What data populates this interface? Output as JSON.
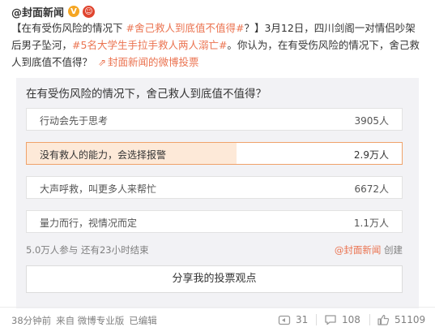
{
  "author": {
    "name": "@封面新闻",
    "verified_mark": "V",
    "emoji": "☺"
  },
  "post": {
    "part1": "【在有受伤风险的情况下 ",
    "topic1": "#舍己救人到底值不值得#",
    "part2": "？】3月12日，四川剑阁一对情侣吵架后男子坠河，",
    "topic2": "#5名大学生手拉手救人两人溺亡#",
    "part3": "。你认为，在有受伤风险的情况下，舍己救人到底值不值得？ ",
    "poll_link": "封面新闻的微博投票",
    "poll_link_icon": "link-icon"
  },
  "poll": {
    "question": "在有受伤风险的情况下，舍己救人到底值不值得？",
    "options": [
      {
        "label": "行动会先于思考",
        "count": "3905人",
        "share": 0.08
      },
      {
        "label": "没有救人的能力，会选择报警",
        "count": "2.9万人",
        "share": 0.56,
        "selected": true
      },
      {
        "label": "大声呼救，叫更多人来帮忙",
        "count": "6672人",
        "share": 0.13
      },
      {
        "label": "量力而行，视情况而定",
        "count": "1.1万人",
        "share": 0.22
      }
    ],
    "meta": "5.0万人参与 还有23小时结束",
    "creator_name": "@封面新闻",
    "creator_suffix": " 创建",
    "share_button": "分享我的投票观点"
  },
  "footer": {
    "time": "38分钟前",
    "source": "来自 微博专业版",
    "edited": "已编辑",
    "repost_count": "31",
    "comment_count": "108",
    "like_count": "51109"
  },
  "colors": {
    "accent": "#eb7350",
    "selected_fill": "#fde9d8",
    "selected_border": "#f0a26a"
  }
}
